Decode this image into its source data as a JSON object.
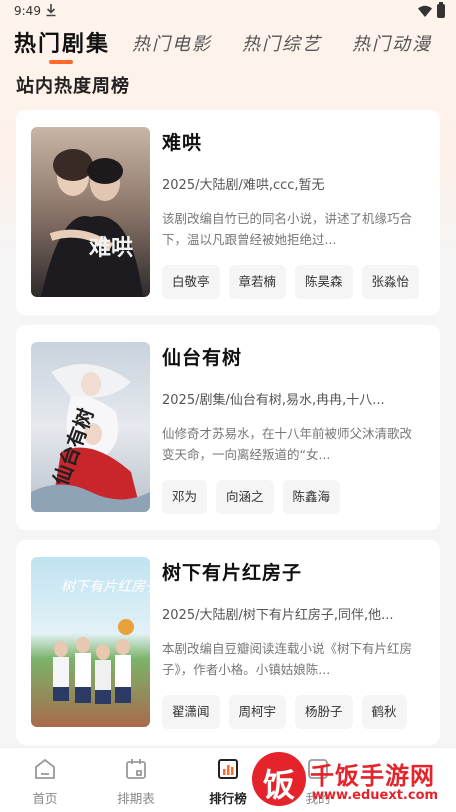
{
  "status_bar": {
    "time": "9:49"
  },
  "tabs": [
    {
      "label": "热门剧集"
    },
    {
      "label": "热门电影"
    },
    {
      "label": "热门综艺"
    },
    {
      "label": "热门动漫"
    }
  ],
  "section_title": "站内热度周榜",
  "dramas": [
    {
      "title": "难哄",
      "meta": "2025/大陆剧/难哄,ccc,暂无",
      "desc": "该剧改编自竹已的同名小说，讲述了机缘巧合下，温以凡跟曾经被她拒绝过...",
      "poster_text": "难哄",
      "actors": [
        "白敬亭",
        "章若楠",
        "陈昊森",
        "张淼怡"
      ]
    },
    {
      "title": "仙台有树",
      "meta": "2025/剧集/仙台有树,易水,冉冉,十八...",
      "desc": "仙修奇才苏易水，在十八年前被师父沐清歌改变天命，一向离经叛道的“女...",
      "poster_text": "仙台有树",
      "actors": [
        "邓为",
        "向涵之",
        "陈鑫海"
      ]
    },
    {
      "title": "树下有片红房子",
      "meta": "2025/大陆剧/树下有片红房子,同伴,他...",
      "desc": "本剧改编自豆瓣阅读连载小说《树下有片红房子》，作者小格。小镇姑娘陈...",
      "poster_text": "树下有片红房子",
      "actors": [
        "翟潇闻",
        "周柯宇",
        "杨朌子",
        "鹤秋"
      ]
    }
  ],
  "bottom_nav": [
    {
      "label": "首页",
      "icon": "home-icon"
    },
    {
      "label": "排期表",
      "icon": "calendar-icon"
    },
    {
      "label": "排行榜",
      "icon": "chart-icon"
    },
    {
      "label": "我的",
      "icon": "profile-icon"
    }
  ],
  "watermark": {
    "circle_char": "饭",
    "title": "千饭手游网",
    "url": "www.eduext.com"
  },
  "colors": {
    "accent": "#ff6a2b",
    "watermark": "#e4232a"
  }
}
